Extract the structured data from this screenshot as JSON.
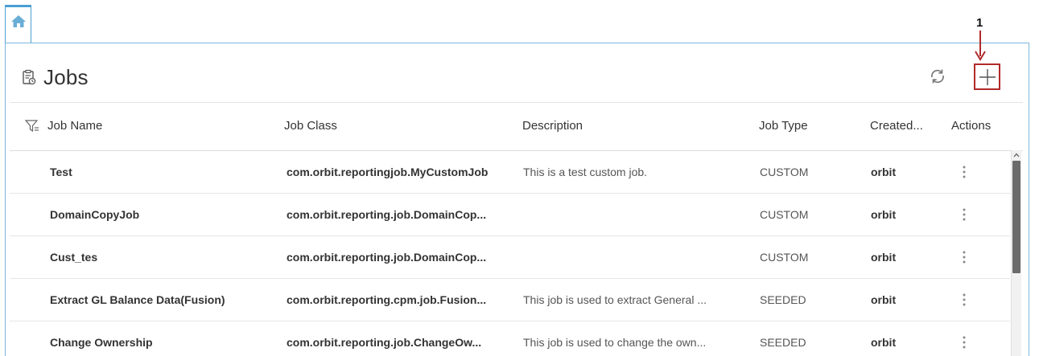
{
  "page": {
    "title": "Jobs"
  },
  "annotation": {
    "number": "1"
  },
  "table": {
    "columns": [
      "Job Name",
      "Job Class",
      "Description",
      "Job Type",
      "Created...",
      "Actions"
    ],
    "rows": [
      {
        "name": "Test",
        "job_class": "com.orbit.reportingjob.MyCustomJob",
        "description": "This is a test custom job.",
        "job_type": "CUSTOM",
        "created_by": "orbit"
      },
      {
        "name": "DomainCopyJob",
        "job_class": "com.orbit.reporting.job.DomainCop...",
        "description": "",
        "job_type": "CUSTOM",
        "created_by": "orbit"
      },
      {
        "name": "Cust_tes",
        "job_class": "com.orbit.reporting.job.DomainCop...",
        "description": "",
        "job_type": "CUSTOM",
        "created_by": "orbit"
      },
      {
        "name": "Extract GL Balance Data(Fusion)",
        "job_class": "com.orbit.reporting.cpm.job.Fusion...",
        "description": "This job is used to extract General ...",
        "job_type": "SEEDED",
        "created_by": "orbit"
      },
      {
        "name": "Change Ownership",
        "job_class": "com.orbit.reporting.job.ChangeOw...",
        "description": "This job is used to change the own...",
        "job_type": "SEEDED",
        "created_by": "orbit"
      }
    ]
  },
  "icons": {
    "home": "home-icon",
    "title": "clipboard-icon",
    "refresh": "refresh-icon",
    "add": "plus-icon",
    "filter": "filter-icon",
    "actions": "kebab-menu-icon"
  },
  "colors": {
    "accent": "#4a9fd4",
    "annotation": "#b02a2a"
  }
}
